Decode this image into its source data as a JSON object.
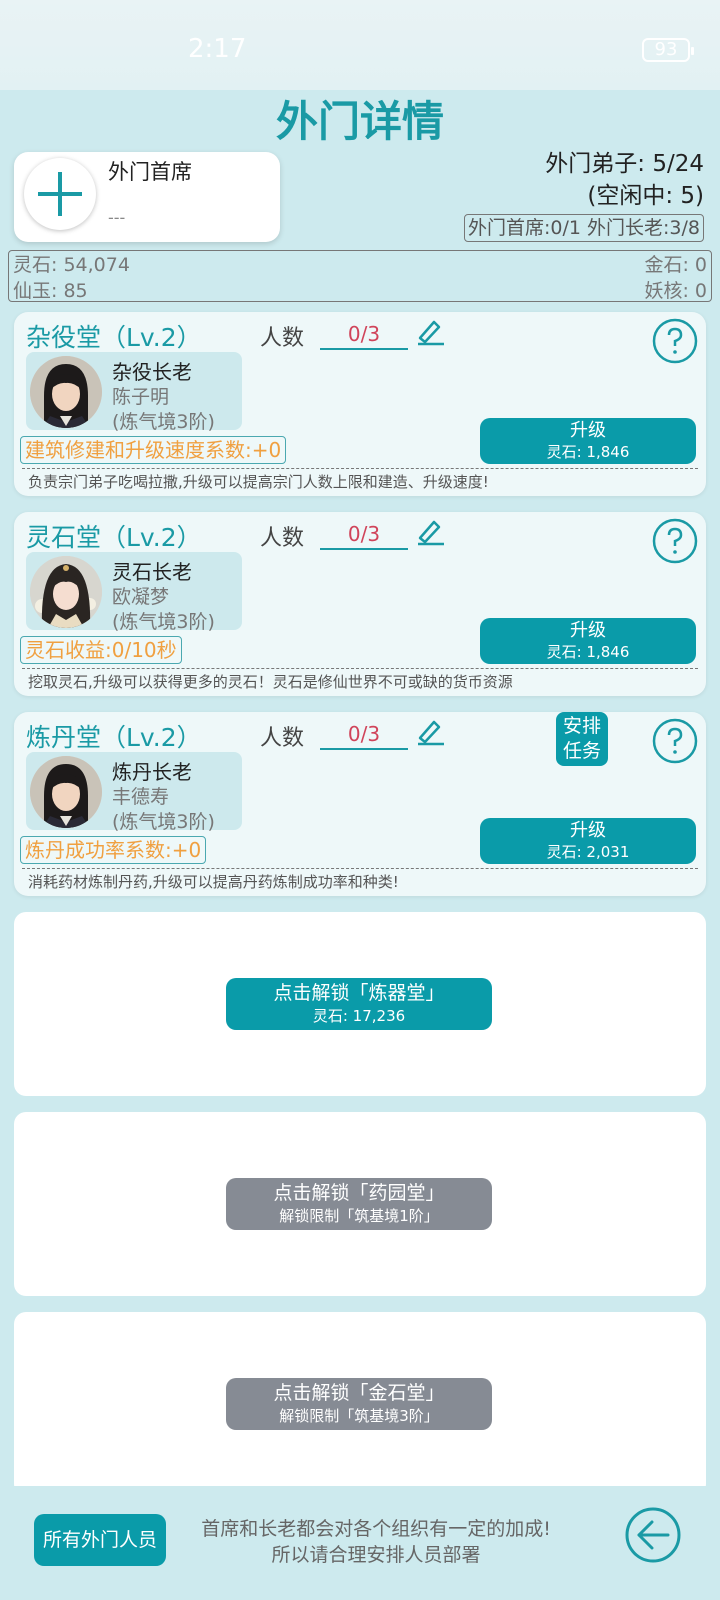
{
  "status_bar": {
    "time": "2:17",
    "battery": "93"
  },
  "page_title": "外门详情",
  "chief": {
    "title": "外门首席",
    "name": "---"
  },
  "disciples": {
    "count_line": "外门弟子: 5/24",
    "idle_line": "(空闲中: 5)"
  },
  "leaders_line": "外门首席:0/1 外门长老:3/8",
  "resources": {
    "lingshi": "灵石: 54,074",
    "jinshi": "金石: 0",
    "xianyu": "仙玉: 85",
    "yaohe": "妖核: 0"
  },
  "halls": [
    {
      "title": "杂役堂（Lv.2）",
      "count_label": "人数",
      "count": "0/3",
      "elder_role": "杂役长老",
      "elder_name": "陈子明",
      "elder_realm": "(炼气境3阶)",
      "bonus": "建筑修建和升级速度系数:+0",
      "upgrade_label": "升级",
      "upgrade_cost": "灵石: 1,846",
      "description": "负责宗门弟子吃喝拉撒,升级可以提高宗门人数上限和建造、升级速度!"
    },
    {
      "title": "灵石堂（Lv.2）",
      "count_label": "人数",
      "count": "0/3",
      "elder_role": "灵石长老",
      "elder_name": "欧凝梦",
      "elder_realm": "(炼气境3阶)",
      "bonus": "灵石收益:0/10秒",
      "upgrade_label": "升级",
      "upgrade_cost": "灵石: 1,846",
      "description": "挖取灵石,升级可以获得更多的灵石！灵石是修仙世界不可或缺的货币资源"
    },
    {
      "title": "炼丹堂（Lv.2）",
      "count_label": "人数",
      "count": "0/3",
      "assign_label": "安排任务",
      "elder_role": "炼丹长老",
      "elder_name": "丰德寿",
      "elder_realm": "(炼气境3阶)",
      "bonus": "炼丹成功率系数:+0",
      "upgrade_label": "升级",
      "upgrade_cost": "灵石: 2,031",
      "description": "消耗药材炼制丹药,升级可以提高丹药炼制成功率和种类!"
    }
  ],
  "locked_halls": [
    {
      "label": "点击解锁「炼器堂」",
      "sub": "灵石: 17,236",
      "available": true
    },
    {
      "label": "点击解锁「药园堂」",
      "sub": "解锁限制「筑基境1阶」",
      "available": false
    },
    {
      "label": "点击解锁「金石堂」",
      "sub": "解锁限制「筑基境3阶」",
      "available": false
    }
  ],
  "footer": {
    "all_members_label": "所有外门人员",
    "tip_line1": "首席和长老都会对各个组织有一定的加成!",
    "tip_line2": "所以请合理安排人员部署"
  },
  "colors": {
    "accent": "#0a9ba9",
    "title": "#1a9aa5",
    "bonus": "#f0a040",
    "count": "#d0445a",
    "locked": "#868b94"
  }
}
